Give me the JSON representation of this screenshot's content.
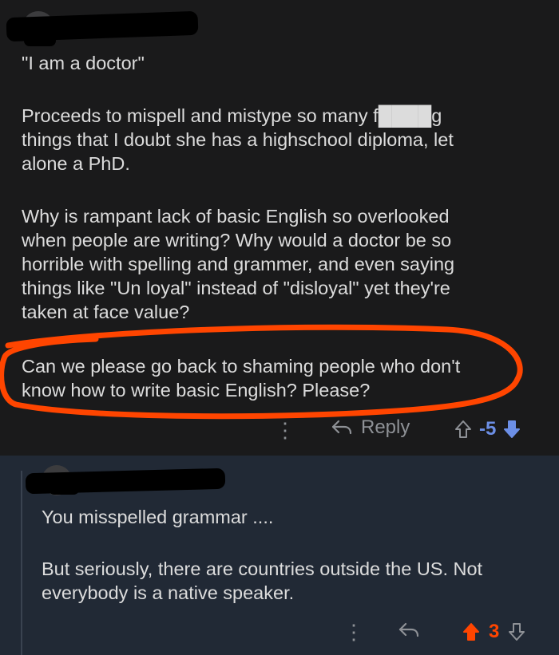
{
  "comment1": {
    "paragraphs": [
      "\"I am a doctor\"",
      "Proceeds to mispell and mistype so many f████g\nthings that I doubt she has a highschool diploma, let\nalone a PhD.",
      "Why is rampant lack of basic English so overlooked\nwhen people are writing? Why would a doctor be so\nhorrible with spelling and grammer, and even saying\nthings like \"Un loyal\" instead of \"disloyal\" yet they're\ntaken at face value?",
      "Can we please go back to shaming people who don't\nknow how to write basic English? Please?"
    ],
    "actions": {
      "more_icon": "more-vertical-icon",
      "reply_label": "Reply",
      "score": "-5",
      "vote_state": "downvoted"
    }
  },
  "comment2": {
    "paragraphs": [
      "You misspelled grammar ....",
      "But seriously, there are countries outside the US. Not\neverybody is a native speaker."
    ],
    "actions": {
      "more_icon": "more-vertical-icon",
      "score": "3",
      "vote_state": "upvoted"
    }
  },
  "colors": {
    "highlight_circle": "#ff4500",
    "upvote": "#ff4500",
    "downvote": "#6c8fe6",
    "bg_main": "#1a1a1b",
    "bg_reply": "#212935"
  }
}
